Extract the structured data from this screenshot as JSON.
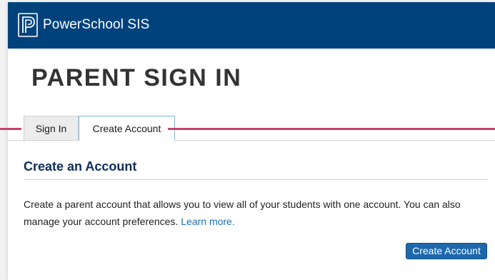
{
  "header": {
    "brand": "PowerSchool SIS",
    "logo_icon": "powerschool-p-logo-icon",
    "background_color": "#00427c"
  },
  "page": {
    "title": "PARENT SIGN IN"
  },
  "tabs": [
    {
      "label": "Sign In",
      "active": false
    },
    {
      "label": "Create Account",
      "active": true
    }
  ],
  "create_account": {
    "heading": "Create an Account",
    "description": "Create a parent account that allows you to view all of your students with one account. You can also manage your account preferences.",
    "learn_more": "Learn more.",
    "button_label": "Create Account"
  },
  "colors": {
    "accent": "#1d68ad",
    "link": "#1f6fb2",
    "annotation_line": "#c8416f"
  }
}
